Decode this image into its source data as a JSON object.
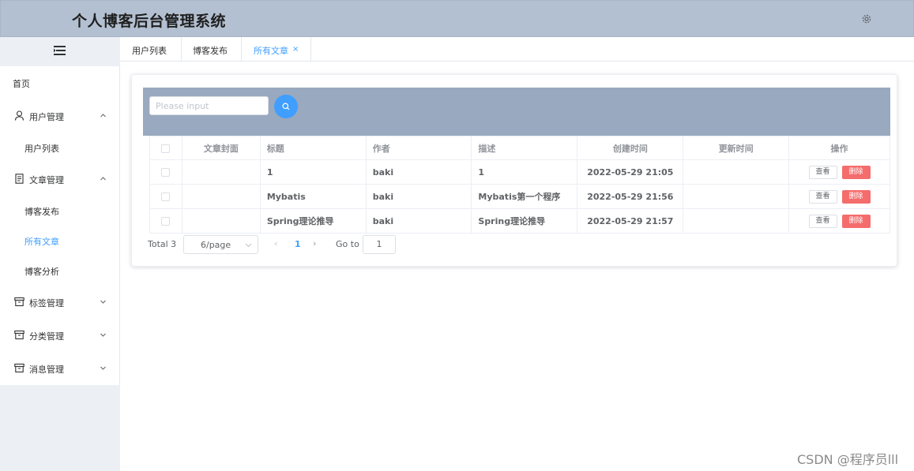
{
  "header": {
    "title": "个人博客后台管理系统",
    "settings_icon": "gear-icon"
  },
  "sidebar": {
    "collapse_icon": "menu-fold-icon",
    "items": [
      {
        "label": "首页"
      },
      {
        "label": "用户管理",
        "icon": "user-icon",
        "expanded": true
      },
      {
        "label": "用户列表"
      },
      {
        "label": "文章管理",
        "icon": "document-icon",
        "expanded": true
      },
      {
        "label": "博客发布"
      },
      {
        "label": "所有文章",
        "active": true
      },
      {
        "label": "博客分析"
      },
      {
        "label": "标签管理",
        "icon": "box-icon",
        "expanded": false
      },
      {
        "label": "分类管理",
        "icon": "box-icon",
        "expanded": false
      },
      {
        "label": "消息管理",
        "icon": "box-icon",
        "expanded": false
      }
    ]
  },
  "tabs": [
    {
      "label": "用户列表"
    },
    {
      "label": "博客发布"
    },
    {
      "label": "所有文章",
      "active": true,
      "close": "×"
    }
  ],
  "search": {
    "placeholder": "Please input",
    "value": ""
  },
  "table": {
    "headers": [
      "文章封面",
      "标题",
      "作者",
      "描述",
      "创建时间",
      "更新时间",
      "操作"
    ],
    "rows": [
      {
        "cover": "",
        "title": "1",
        "author": "baki",
        "desc": "1",
        "created": "2022-05-29 21:05",
        "updated": "",
        "view": "查看",
        "delete": "删除"
      },
      {
        "cover": "",
        "title": "Mybatis",
        "author": "baki",
        "desc": "Mybatis第一个程序",
        "created": "2022-05-29 21:56",
        "updated": "",
        "view": "查看",
        "delete": "删除"
      },
      {
        "cover": "",
        "title": "Spring理论推导",
        "author": "baki",
        "desc": "Spring理论推导",
        "created": "2022-05-29 21:57",
        "updated": "",
        "view": "查看",
        "delete": "删除"
      }
    ]
  },
  "pagination": {
    "total": "Total 3",
    "page_size": "6/page",
    "current_page": "1",
    "goto_label": "Go to",
    "goto_value": "1"
  },
  "colors": {
    "accent": "#409eff",
    "danger": "#f56c6c",
    "header_bg": "#b3c0d1",
    "search_bg": "#99a9bf"
  },
  "watermark": "CSDN @程序员lll"
}
